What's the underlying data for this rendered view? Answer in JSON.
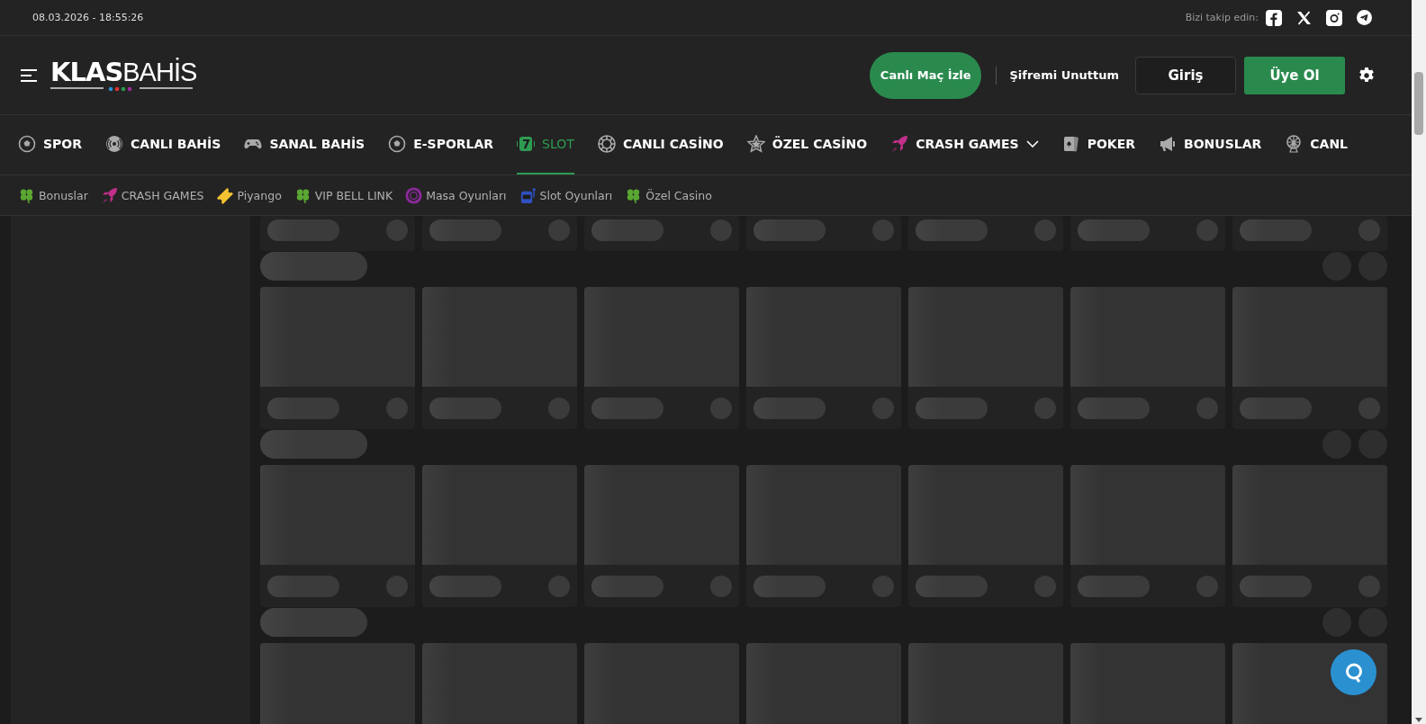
{
  "top_bar": {
    "datetime": "08.03.2026 - 18:55:26",
    "follow_label": "Bizi takip edin:"
  },
  "header": {
    "logo": {
      "bold": "KLAS",
      "light": "BAHİS"
    },
    "live_button": "Canlı Maç İzle",
    "forgot_link": "Şifremi Unuttum",
    "login_button": "Giriş",
    "register_button": "Üye Ol"
  },
  "main_nav": [
    {
      "label": "SPOR",
      "selected": false,
      "dropdown": false
    },
    {
      "label": "CANLI BAHİS",
      "selected": false,
      "dropdown": false
    },
    {
      "label": "SANAL BAHİS",
      "selected": false,
      "dropdown": false
    },
    {
      "label": "E-SPORLAR",
      "selected": false,
      "dropdown": false
    },
    {
      "label": "SLOT",
      "selected": true,
      "dropdown": false
    },
    {
      "label": "CANLI CASİNO",
      "selected": false,
      "dropdown": false
    },
    {
      "label": "ÖZEL CASİNO",
      "selected": false,
      "dropdown": false
    },
    {
      "label": "CRASH GAMES",
      "selected": false,
      "dropdown": true
    },
    {
      "label": "POKER",
      "selected": false,
      "dropdown": false
    },
    {
      "label": "BONUSLAR",
      "selected": false,
      "dropdown": false
    },
    {
      "label": "CANL",
      "selected": false,
      "dropdown": false
    }
  ],
  "sub_nav": [
    {
      "label": "Bonuslar"
    },
    {
      "label": "CRASH GAMES"
    },
    {
      "label": "Piyango"
    },
    {
      "label": "VIP BELL LINK"
    },
    {
      "label": "Masa Oyunları"
    },
    {
      "label": "Slot Oyunları"
    },
    {
      "label": "Özel Casino"
    }
  ],
  "game_rows": [
    {
      "kind": "partial"
    },
    {
      "kind": "full"
    },
    {
      "kind": "full"
    },
    {
      "kind": "top"
    }
  ]
}
